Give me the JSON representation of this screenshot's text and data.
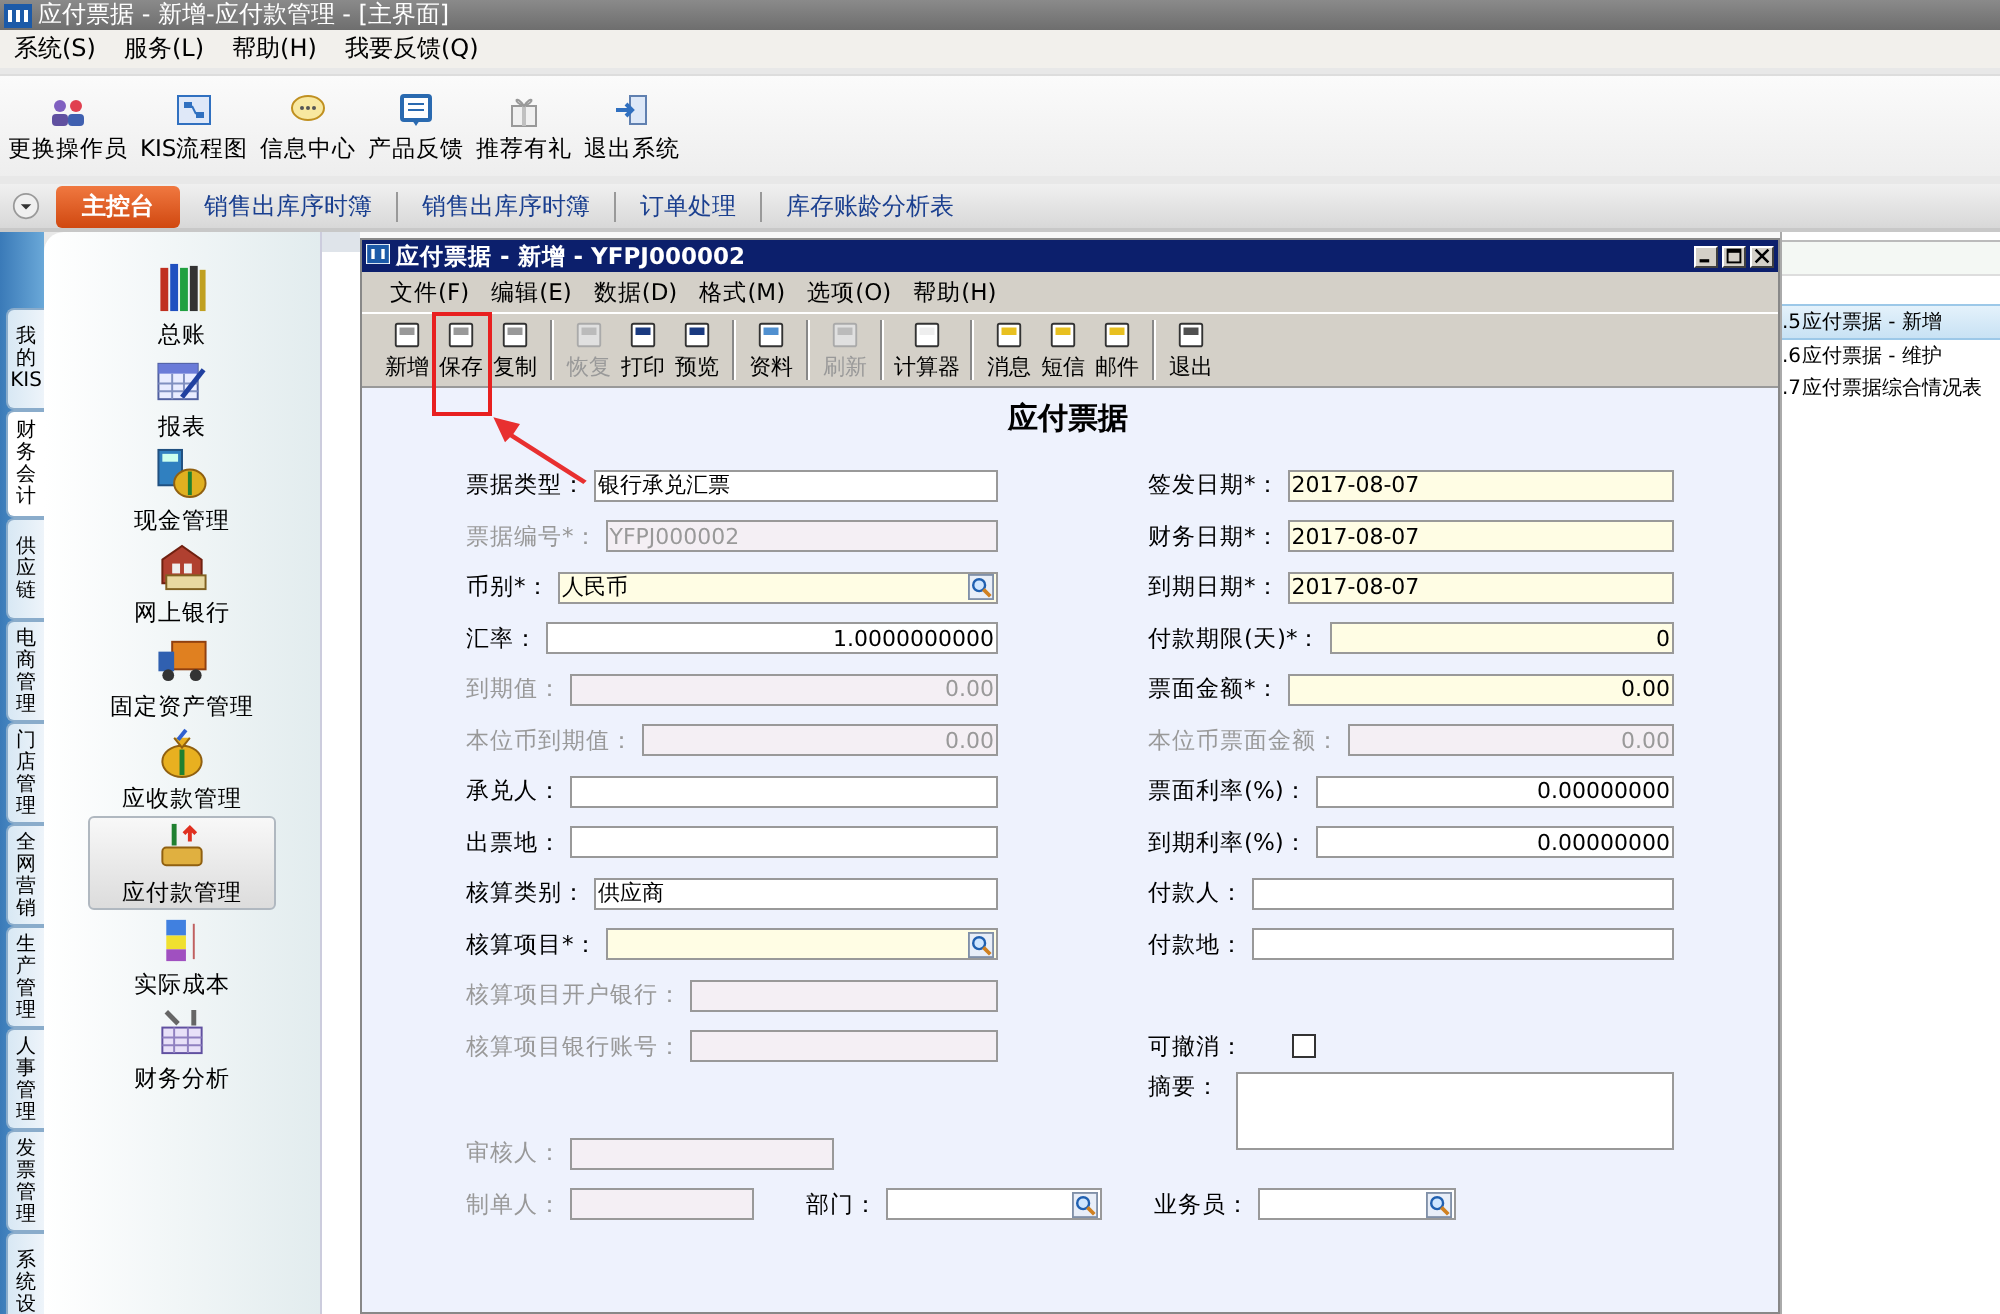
{
  "window": {
    "title": "应付票据 - 新增-应付款管理 - [主界面]"
  },
  "menu": [
    "系统(S)",
    "服务(L)",
    "帮助(H)",
    "我要反馈(Q)"
  ],
  "toolbar": [
    {
      "label": "更换操作员"
    },
    {
      "label": "KIS流程图"
    },
    {
      "label": "信息中心"
    },
    {
      "label": "产品反馈"
    },
    {
      "label": "推荐有礼"
    },
    {
      "label": "退出系统"
    }
  ],
  "tabs": [
    {
      "label": "主控台",
      "selected": true
    },
    {
      "label": "销售出库序时簿",
      "selected": false
    },
    {
      "label": "销售出库序时簿",
      "selected": false
    },
    {
      "label": "订单处理",
      "selected": false
    },
    {
      "label": "库存账龄分析表",
      "selected": false
    }
  ],
  "side_tabs": [
    {
      "label": "我的KIS",
      "selected": false
    },
    {
      "label": "财务会计",
      "selected": true
    },
    {
      "label": "供应链",
      "selected": false
    },
    {
      "label": "电商管理",
      "selected": false
    },
    {
      "label": "门店管理",
      "selected": false
    },
    {
      "label": "全网营销",
      "selected": false
    },
    {
      "label": "生产管理",
      "selected": false
    },
    {
      "label": "人事管理",
      "selected": false
    },
    {
      "label": "发票管理",
      "selected": false
    },
    {
      "label": "系统设",
      "selected": false
    }
  ],
  "nav": [
    {
      "label": "总账",
      "selected": false
    },
    {
      "label": "报表",
      "selected": false
    },
    {
      "label": "现金管理",
      "selected": false
    },
    {
      "label": "网上银行",
      "selected": false
    },
    {
      "label": "固定资产管理",
      "selected": false
    },
    {
      "label": "应收款管理",
      "selected": false
    },
    {
      "label": "应付款管理",
      "selected": true
    },
    {
      "label": "实际成本",
      "selected": false
    },
    {
      "label": "财务分析",
      "selected": false
    }
  ],
  "right_list": [
    {
      "number": ".5",
      "label": "应付票据 - 新增",
      "selected": true
    },
    {
      "number": ".6",
      "label": "应付票据 - 维护",
      "selected": false
    },
    {
      "number": ".7",
      "label": "应付票据综合情况表",
      "selected": false
    }
  ],
  "dialog": {
    "title": "应付票据 - 新增 - YFPJ000002",
    "menu": [
      "文件(F)",
      "编辑(E)",
      "数据(D)",
      "格式(M)",
      "选项(O)",
      "帮助(H)"
    ],
    "toolbar": [
      [
        {
          "label": "新增",
          "disabled": false,
          "highlighted": false
        },
        {
          "label": "保存",
          "disabled": false,
          "highlighted": true
        },
        {
          "label": "复制",
          "disabled": false,
          "highlighted": false
        }
      ],
      [
        {
          "label": "恢复",
          "disabled": true,
          "highlighted": false
        },
        {
          "label": "打印",
          "disabled": false,
          "highlighted": false
        },
        {
          "label": "预览",
          "disabled": false,
          "highlighted": false
        }
      ],
      [
        {
          "label": "资料",
          "disabled": false,
          "highlighted": false
        }
      ],
      [
        {
          "label": "刷新",
          "disabled": true,
          "highlighted": false
        }
      ],
      [
        {
          "label": "计算器",
          "disabled": false,
          "highlighted": false
        }
      ],
      [
        {
          "label": "消息",
          "disabled": false,
          "highlighted": false
        },
        {
          "label": "短信",
          "disabled": false,
          "highlighted": false
        },
        {
          "label": "邮件",
          "disabled": false,
          "highlighted": false
        }
      ],
      [
        {
          "label": "退出",
          "disabled": false,
          "highlighted": false
        }
      ]
    ],
    "heading": "应付票据",
    "left_fields": [
      {
        "label": "票据类型：",
        "value": "银行承兑汇票",
        "kind": "text",
        "disabled": false,
        "mandatory": false
      },
      {
        "label": "票据编号*：",
        "value": "YFPJ000002",
        "kind": "text",
        "disabled": true,
        "mandatory": false
      },
      {
        "label": "币别*：",
        "value": "人民币",
        "kind": "lookup",
        "disabled": false,
        "mandatory": true
      },
      {
        "label": "汇率：",
        "value": "1.0000000000",
        "kind": "number",
        "disabled": false,
        "mandatory": false
      },
      {
        "label": "到期值：",
        "value": "0.00",
        "kind": "number",
        "disabled": true,
        "mandatory": false
      },
      {
        "label": "本位币到期值：",
        "value": "0.00",
        "kind": "number",
        "disabled": true,
        "mandatory": false
      },
      {
        "label": "承兑人：",
        "disabled": false,
        "mandatory": false
      },
      {
        "label": "出票地：",
        "disabled": false,
        "mandatory": false
      },
      {
        "label": "核算类别：",
        "value": "供应商",
        "kind": "text",
        "disabled": false,
        "mandatory": false
      },
      {
        "label": "核算项目*：",
        "kind": "lookup",
        "disabled": false,
        "mandatory": true
      },
      {
        "label": "核算项目开户银行：",
        "disabled": true,
        "mandatory": false
      },
      {
        "label": "核算项目银行账号：",
        "disabled": true,
        "mandatory": false
      }
    ],
    "right_fields": [
      {
        "label": "签发日期*：",
        "value": "2017-08-07",
        "kind": "text",
        "disabled": false,
        "mandatory": true
      },
      {
        "label": "财务日期*：",
        "value": "2017-08-07",
        "kind": "text",
        "disabled": false,
        "mandatory": true
      },
      {
        "label": "到期日期*：",
        "value": "2017-08-07",
        "kind": "text",
        "disabled": false,
        "mandatory": true
      },
      {
        "label": "付款期限(天)*：",
        "value": "0",
        "kind": "number",
        "disabled": false,
        "mandatory": true
      },
      {
        "label": "票面金额*：",
        "value": "0.00",
        "kind": "number",
        "disabled": false,
        "mandatory": true
      },
      {
        "label": "本位币票面金额：",
        "value": "0.00",
        "kind": "number",
        "disabled": true,
        "mandatory": false
      },
      {
        "label": "票面利率(%)：",
        "value": "0.00000000",
        "kind": "number",
        "disabled": false,
        "mandatory": false
      },
      {
        "label": "到期利率(%)：",
        "value": "0.00000000",
        "kind": "number",
        "disabled": false,
        "mandatory": false
      },
      {
        "label": "付款人：",
        "disabled": false,
        "mandatory": false
      },
      {
        "label": "付款地：",
        "disabled": false,
        "mandatory": false
      }
    ],
    "cancellable": {
      "label": "可撤消：",
      "checked": false
    },
    "summary": {
      "label": "摘要："
    },
    "reviewer": {
      "label": "审核人：",
      "disabled": true
    },
    "bottom_fields": [
      {
        "label": "制单人：",
        "disabled": true
      },
      {
        "label": "部门：",
        "kind": "lookup",
        "disabled": false,
        "mandatory": false
      },
      {
        "label": "业务员：",
        "kind": "lookup",
        "disabled": false,
        "mandatory": false
      }
    ]
  }
}
